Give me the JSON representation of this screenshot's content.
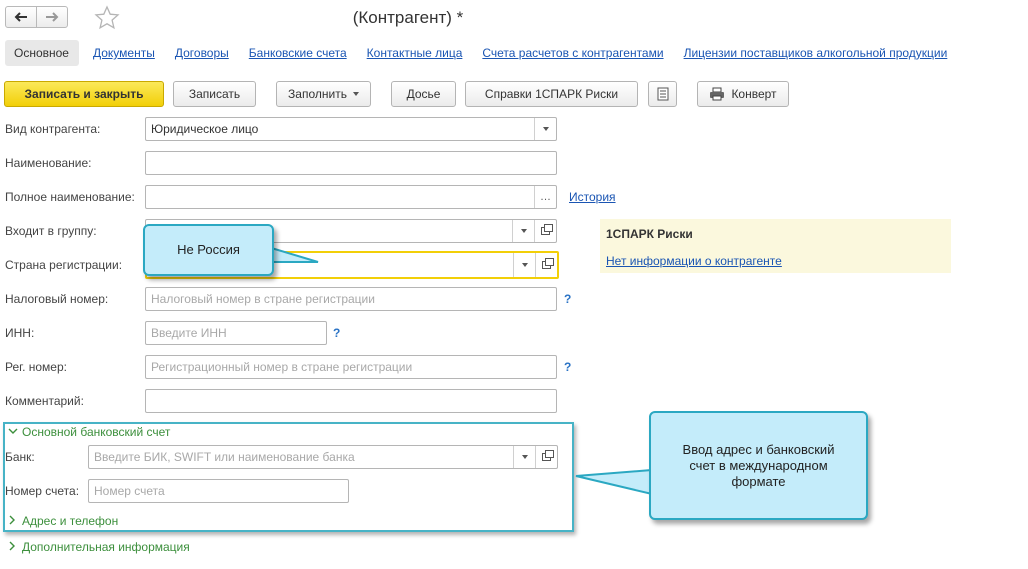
{
  "header": {
    "title": "(Контрагент) *",
    "back_icon": "arrow-left-icon",
    "forward_icon": "arrow-right-icon",
    "favorite_icon": "star-icon"
  },
  "tabs": [
    {
      "label": "Основное",
      "active": true
    },
    {
      "label": "Документы"
    },
    {
      "label": "Договоры"
    },
    {
      "label": "Банковские счета"
    },
    {
      "label": "Контактные лица"
    },
    {
      "label": "Счета расчетов с контрагентами"
    },
    {
      "label": "Лицензии поставщиков алкогольной продукции"
    }
  ],
  "toolbar": {
    "save_close": "Записать и закрыть",
    "save": "Записать",
    "fill": "Заполнить",
    "dossier": "Досье",
    "spark_reports": "Справки 1СПАРК Риски",
    "envelope": "Конверт"
  },
  "form": {
    "kind_label": "Вид контрагента:",
    "kind_value": "Юридическое лицо",
    "name_label": "Наименование:",
    "name_value": "",
    "fullname_label": "Полное наименование:",
    "fullname_value": "",
    "history_link": "История",
    "group_label": "Входит в группу:",
    "group_value": "",
    "country_label": "Страна регистрации:",
    "country_value": "",
    "tax_label": "Налоговый номер:",
    "tax_placeholder": "Налоговый номер в стране регистрации",
    "inn_label": "ИНН:",
    "inn_placeholder": "Введите ИНН",
    "reg_label": "Рег. номер:",
    "reg_placeholder": "Регистрационный номер в стране регистрации",
    "comment_label": "Комментарий:",
    "comment_value": "",
    "help_mark": "?"
  },
  "spark": {
    "title": "1СПАРК Риски",
    "link": "Нет информации о контрагенте"
  },
  "bank_section": {
    "title": "Основной банковский счет",
    "bank_label": "Банк:",
    "bank_placeholder": "Введите БИК, SWIFT или наименование банка",
    "account_label": "Номер счета:",
    "account_placeholder": "Номер счета"
  },
  "address_section": {
    "title": "Адрес и телефон"
  },
  "extra_section": {
    "title": "Дополнительная информация"
  },
  "callouts": {
    "country": "Не Россия",
    "bank": "Ввод адрес и банковский счет в международном формате"
  },
  "colors": {
    "accent_yellow": "#f2cf08",
    "link_blue": "#1a55b3",
    "section_green": "#3c8f3c",
    "callout_bg": "#c4ecfa",
    "callout_border": "#2ba8c2",
    "spark_bg": "#fbf8dd"
  }
}
